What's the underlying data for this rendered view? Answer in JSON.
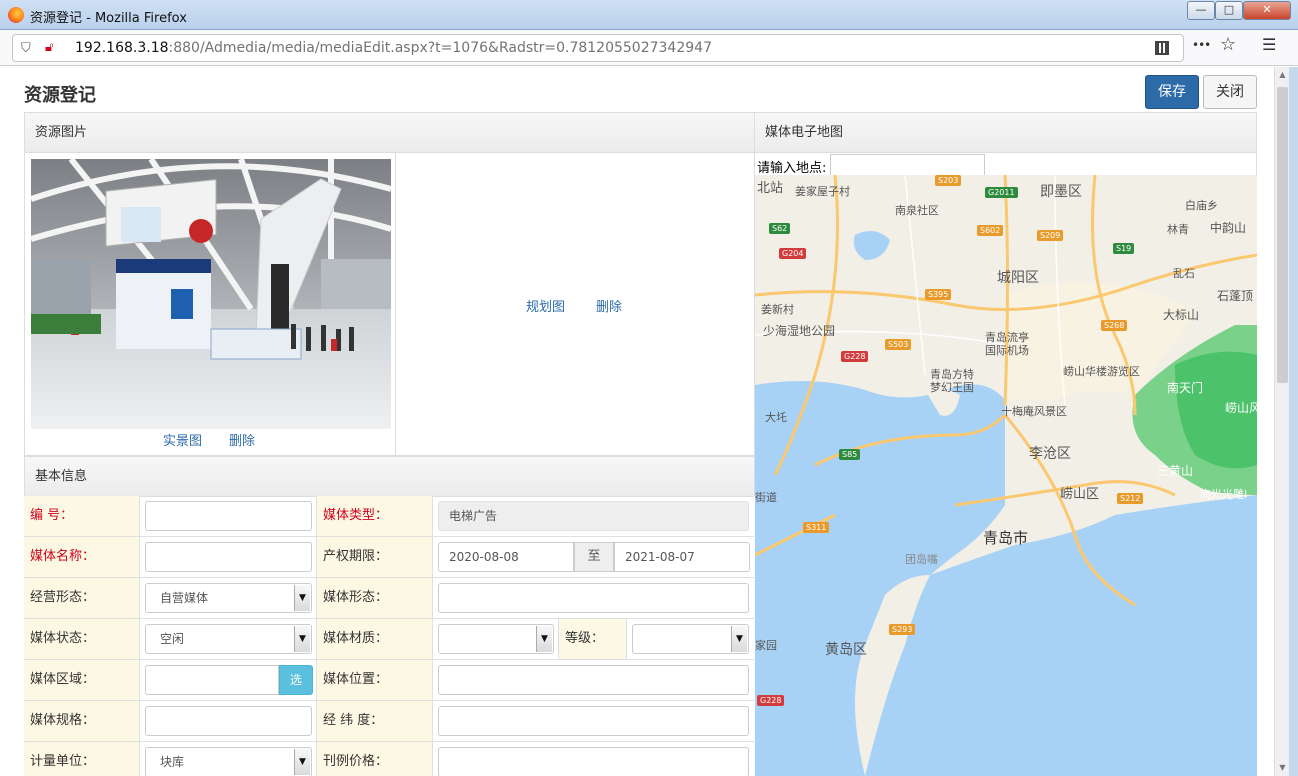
{
  "window": {
    "title": "资源登记 - Mozilla Firefox",
    "min": "—",
    "max": "□",
    "close": "✕"
  },
  "browser": {
    "url_host": "192.168.3.18",
    "url_path": ":880/Admedia/media/mediaEdit.aspx?t=1076&Radstr=0.7812055027342947",
    "more_icon": "•••",
    "star_icon": "☆",
    "menu_icon": "☰"
  },
  "page": {
    "title": "资源登记",
    "save_label": "保存",
    "close_label": "关闭"
  },
  "images_panel": {
    "header": "资源图片",
    "photo_link": "实景图",
    "photo_delete": "删除",
    "plan_link": "规划图",
    "plan_delete": "删除"
  },
  "map_panel": {
    "header": "媒体电子地图",
    "search_label": "请输入地点:",
    "search_value": "",
    "labels": [
      "北站",
      "姜家屋子村",
      "南泉社区",
      "即墨区",
      "中韵山",
      "白庙乡",
      "林青",
      "乱石",
      "石蓬顶",
      "大标山",
      "城阳区",
      "姜新村",
      "少海湿地公园",
      "青岛流亭国际机场",
      "崂山华楼游览区",
      "青岛方特梦幻王国",
      "南天门",
      "崂山风",
      "十梅庵风景区",
      "大圫",
      "李沧区",
      "三黄山",
      "崂山区",
      "南光光雕I",
      "街道",
      "青岛市",
      "团岛嘴",
      "黄岛区",
      "家园"
    ],
    "roads": [
      "S203",
      "G2011",
      "S602",
      "S209",
      "S62",
      "S19",
      "G204",
      "S395",
      "S268",
      "G228",
      "S503",
      "S85",
      "S311",
      "S212",
      "S293",
      "G228"
    ]
  },
  "basic_info": {
    "header": "基本信息",
    "rows": [
      {
        "label1": "编    号：",
        "value1": "",
        "label2": "媒体类型：",
        "value2": "电梯广告"
      },
      {
        "label1": "媒体名称：",
        "value1": "",
        "label2": "产权期限：",
        "date_from": "2020-08-08",
        "date_sep": "至",
        "date_to": "2021-08-07"
      },
      {
        "label1": "经营形态：",
        "value1": "自营媒体",
        "label2": "媒体形态：",
        "value2": ""
      },
      {
        "label1": "媒体状态：",
        "value1": "空闲",
        "label2": "媒体材质：",
        "value2": "",
        "label3": "等级：",
        "value3": ""
      },
      {
        "label1": "媒体区域：",
        "value1": "",
        "choose": "选",
        "label2": "媒体位置：",
        "value2": ""
      },
      {
        "label1": "媒体规格：",
        "value1": "",
        "label2": "经 纬 度：",
        "value2": ""
      },
      {
        "label1": "计量单位：",
        "value1": "块库",
        "label2": "刊例价格：",
        "value2": ""
      }
    ]
  },
  "colors": {
    "primary": "#2c6aa8",
    "label_bg": "#fcf8e3",
    "required": "#d0021b",
    "info": "#5bc0de"
  }
}
